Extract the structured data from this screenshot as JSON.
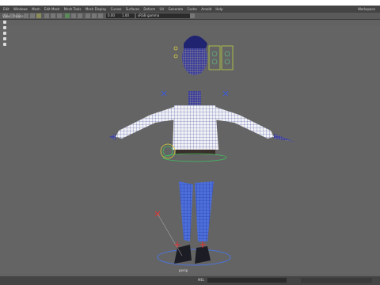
{
  "menu": {
    "items": [
      "Edit",
      "Windows",
      "Mesh",
      "Edit Mesh",
      "Mesh Tools",
      "Mesh Display",
      "Curves",
      "Surfaces",
      "Deform",
      "UV",
      "Generate",
      "Cache",
      "Arnold",
      "Help"
    ],
    "workspace": "Workspace"
  },
  "status": {
    "time_value": "0.00",
    "scale_value": "1.00",
    "colorspace": "sRGB gamma"
  },
  "panel_menu": [
    "View",
    "Panels"
  ],
  "viewport": {
    "camera_label": "persp",
    "background": "#646464",
    "wire_color": "#1e33aa",
    "mesh_color": "#4d6fd8"
  },
  "command_line": {
    "mel_label": "MEL"
  }
}
